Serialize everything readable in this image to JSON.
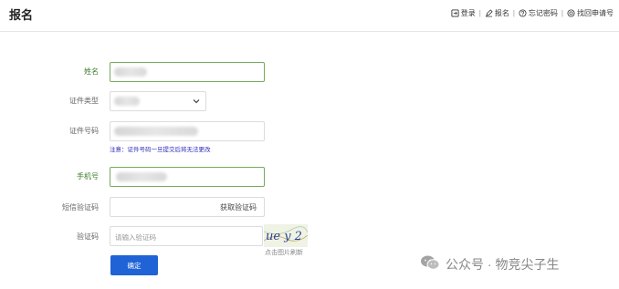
{
  "header": {
    "title": "报名",
    "nav": [
      {
        "label": "登录",
        "icon": "login-icon"
      },
      {
        "label": "报名",
        "icon": "edit-icon"
      },
      {
        "label": "忘记密码",
        "icon": "question-icon"
      },
      {
        "label": "找回申请号",
        "icon": "target-icon"
      }
    ]
  },
  "form": {
    "name_label": "姓名",
    "id_type_label": "证件类型",
    "id_number_label": "证件号码",
    "id_hint": "注意：证件号码一旦提交后将无法更改",
    "phone_label": "手机号",
    "sms_label": "短信验证码",
    "sms_button": "获取验证码",
    "captcha_label": "验证码",
    "captcha_placeholder": "请输入验证码",
    "captcha_text": "ue y 2",
    "captcha_refresh": "点击图片刷新",
    "submit": "确定"
  },
  "watermark": {
    "text": "公众号 · 物竞尖子生",
    "icon": "wechat-icon"
  },
  "colors": {
    "accent": "#1f63d6",
    "required_label": "#3d7a2a",
    "focus_border": "#78a95f",
    "hint": "#2b2bb8"
  }
}
